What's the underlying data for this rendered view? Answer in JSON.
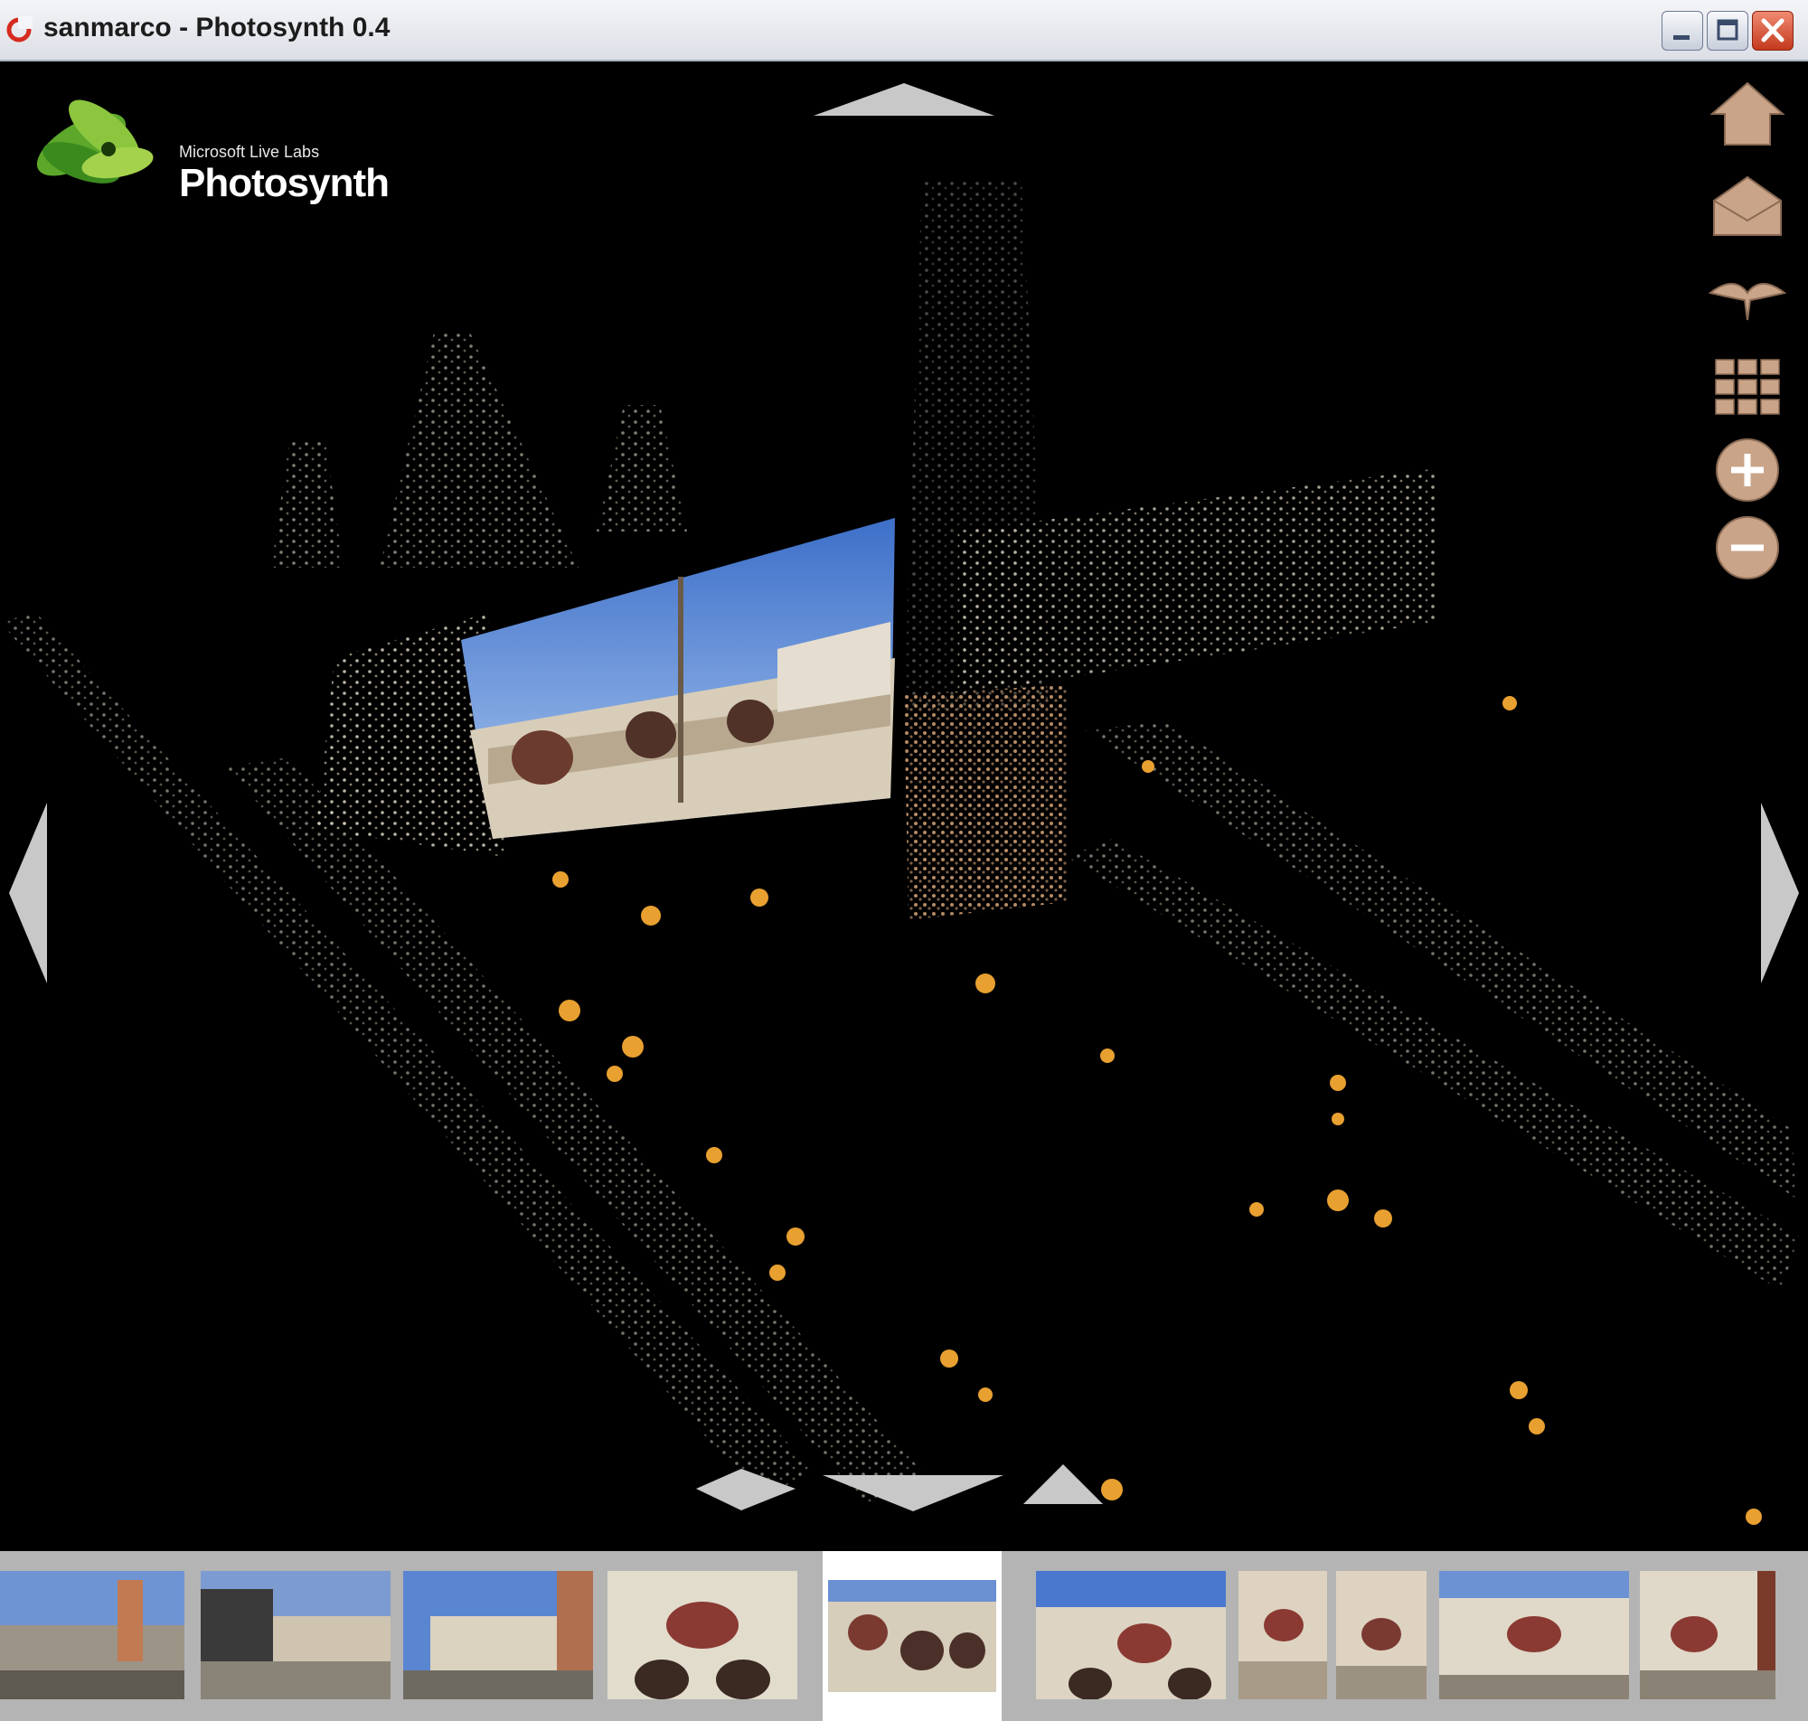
{
  "window": {
    "title": "sanmarco - Photosynth 0.4"
  },
  "logo": {
    "small_text": "Microsoft Live Labs",
    "name": "Photosynth"
  },
  "nav": {
    "up": "up-arrow",
    "down": "down-arrow",
    "left": "left-arrow",
    "right": "right-arrow"
  },
  "toolbar": {
    "items": [
      {
        "icon": "home-icon"
      },
      {
        "icon": "envelope-icon"
      },
      {
        "icon": "bird-overview-icon"
      },
      {
        "icon": "grid-icon"
      },
      {
        "icon": "zoom-in-icon"
      },
      {
        "icon": "zoom-out-icon"
      }
    ]
  },
  "filmstrip": {
    "thumbnail_count": 10,
    "selected_index": 4
  },
  "colors": {
    "titlebar": "#dcdfe6",
    "background": "#000000",
    "accent_orange": "#e8a030",
    "filmstrip": "#b4b4b4"
  }
}
